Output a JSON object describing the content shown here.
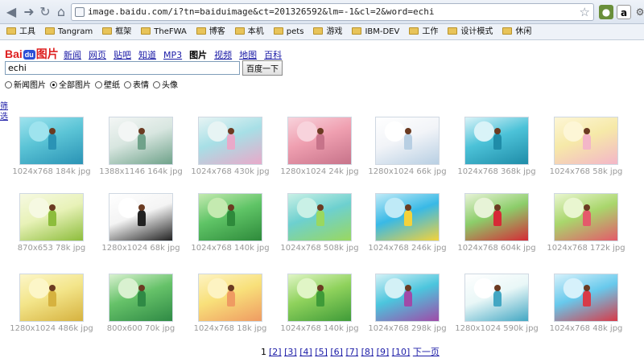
{
  "browser": {
    "url": "image.baidu.com/i?tn=baiduimage&ct=201326592&lm=-1&cl=2&word=echi",
    "bookmarks": [
      "工具",
      "Tangram",
      "框架",
      "TheFWA",
      "博客",
      "本机",
      "pets",
      "游戏",
      "IBM-DEV",
      "工作",
      "设计模式",
      "休闲"
    ]
  },
  "baidu": {
    "logo_text": "Bai",
    "logo_paw": "du",
    "logo_suffix": "图片",
    "channels": [
      "新闻",
      "网页",
      "贴吧",
      "知道",
      "MP3",
      "图片",
      "视频",
      "地图",
      "百科"
    ],
    "current_channel": "图片",
    "query": "echi",
    "search_button": "百度一下",
    "radios": [
      "新闻图片",
      "全部图片",
      "壁纸",
      "表情",
      "头像"
    ],
    "selected_radio": "全部图片",
    "filter_label": "筛选"
  },
  "results": [
    {
      "size": "1024x768 184k jpg",
      "colors": [
        "#5bc4d6",
        "#2a93b5",
        "#9ee3ee"
      ]
    },
    {
      "size": "1388x1146 164k jpg",
      "colors": [
        "#d8e6e0",
        "#6fa28a",
        "#f3f6f5"
      ]
    },
    {
      "size": "1024x768 430k jpg",
      "colors": [
        "#a7dfe6",
        "#e9a9c9",
        "#e7f4f4"
      ]
    },
    {
      "size": "1280x1024 24k jpg",
      "colors": [
        "#ef9fb0",
        "#c7738a",
        "#f8d3dc"
      ]
    },
    {
      "size": "1280x1024 66k jpg",
      "colors": [
        "#f2f4f8",
        "#b8cfe3",
        "#ffffff"
      ]
    },
    {
      "size": "1024x768 368k jpg",
      "colors": [
        "#4cc2d8",
        "#1f8ca8",
        "#d9f3f8"
      ]
    },
    {
      "size": "1024x768 58k jpg",
      "colors": [
        "#f6e9a8",
        "#f3b6c8",
        "#fdf6d6"
      ]
    },
    {
      "size": "870x653 78k jpg",
      "colors": [
        "#e8f2b8",
        "#8dbd3c",
        "#f6f9e2"
      ]
    },
    {
      "size": "1280x1024 68k jpg",
      "colors": [
        "#f4f4f4",
        "#222222",
        "#ffffff"
      ]
    },
    {
      "size": "1024x768 140k jpg",
      "colors": [
        "#5fc466",
        "#2e8a3b",
        "#c4eab0"
      ]
    },
    {
      "size": "1024x768 508k jpg",
      "colors": [
        "#6dd0cf",
        "#9ad85f",
        "#c9f0e6"
      ]
    },
    {
      "size": "1024x768 246k jpg",
      "colors": [
        "#39b9e6",
        "#f4d23a",
        "#bfeaf7"
      ]
    },
    {
      "size": "1024x768 604k jpg",
      "colors": [
        "#8ccd6a",
        "#d62a36",
        "#e7f3d7"
      ]
    },
    {
      "size": "1024x768 172k jpg",
      "colors": [
        "#a9d66c",
        "#e45a6b",
        "#e9f6d0"
      ]
    },
    {
      "size": "1280x1024 486k jpg",
      "colors": [
        "#f3e58a",
        "#d6b23f",
        "#fcf6c8"
      ]
    },
    {
      "size": "800x600 70k jpg",
      "colors": [
        "#66c269",
        "#2f8a45",
        "#d9f1d0"
      ]
    },
    {
      "size": "1024x768 18k jpg",
      "colors": [
        "#f8e07a",
        "#ef9b62",
        "#fdf3c2"
      ]
    },
    {
      "size": "1024x768 140k jpg",
      "colors": [
        "#8fd25c",
        "#3f9b38",
        "#e0f5c6"
      ]
    },
    {
      "size": "1024x768 298k jpg",
      "colors": [
        "#4cc5dd",
        "#a04aa8",
        "#d3f1f6"
      ]
    },
    {
      "size": "1280x1024 590k jpg",
      "colors": [
        "#e9f7f7",
        "#43a7c3",
        "#ffffff"
      ]
    },
    {
      "size": "1024x768 48k jpg",
      "colors": [
        "#68c9ec",
        "#d83a48",
        "#d6f1fb"
      ]
    }
  ],
  "pagination": {
    "current": "1",
    "pages": [
      "[2]",
      "[3]",
      "[4]",
      "[5]",
      "[6]",
      "[7]",
      "[8]",
      "[9]",
      "[10]"
    ],
    "next": "下一页"
  },
  "colors": {
    "link": "#1a1aa6",
    "logo_red": "#de1f1f",
    "logo_blue": "#2a4fd6",
    "meta_text": "#999999"
  }
}
